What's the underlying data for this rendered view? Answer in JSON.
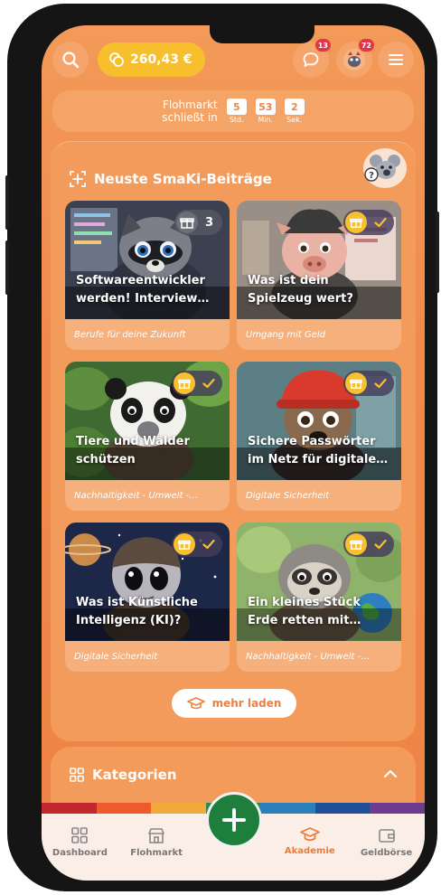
{
  "header": {
    "balance": "260,43 €",
    "chat_badge": "13",
    "avatar_badge": "72",
    "icons": [
      "search-icon",
      "coins-icon",
      "chat-bubble-icon",
      "avatar-icon",
      "hamburger-menu-icon"
    ]
  },
  "countdown": {
    "label_line1": "Flohmarkt",
    "label_line2": "schließt in",
    "hours": "5",
    "hours_unit": "Std.",
    "minutes": "53",
    "minutes_unit": "Min.",
    "seconds": "2",
    "seconds_unit": "Sek."
  },
  "latest": {
    "title": "Neuste SmaKi-Beiträge",
    "mascot_question": "?",
    "cards": [
      {
        "title": "Softwareentwickler\nwerden! Interview…",
        "category": "Berufe für deine Zukunft",
        "badge": "3",
        "badge_type": "gift",
        "image": "raccoon-developer"
      },
      {
        "title": "Was ist dein\nSpielzeug wert?",
        "category": "Umgang mit Geld",
        "badge_type": "done",
        "image": "pig-toys"
      },
      {
        "title": "Tiere und Wälder\nschützen",
        "category": "Nachhaltigkeit - Umwelt -…",
        "badge_type": "done",
        "image": "panda-forest"
      },
      {
        "title": "Sichere Passwörter\nim Netz für digitale…",
        "category": "Digitale Sicherheit",
        "badge_type": "done",
        "image": "dog-red-hat"
      },
      {
        "title": "Was ist Künstliche\nIntelligenz (KI)?",
        "category": "Digitale Sicherheit",
        "badge_type": "done",
        "image": "alien-space"
      },
      {
        "title": "Ein kleines Stück\nErde retten mit…",
        "category": "Nachhaltigkeit - Umwelt -…",
        "badge_type": "done",
        "image": "sloth-earth"
      }
    ],
    "more_label": "mehr laden"
  },
  "categories": {
    "title": "Kategorien"
  },
  "colors": {
    "accent": "#ee8445",
    "coin": "#f7bf2e",
    "fab": "#1e7e3c",
    "rainbow": [
      "#c1272d",
      "#ef5a2a",
      "#f2a93b",
      "#2e8b57",
      "#2a7fb8",
      "#1f4f99",
      "#6d3c8f"
    ]
  },
  "nav": {
    "items": [
      {
        "label": "Dashboard",
        "icon": "grid-icon"
      },
      {
        "label": "Flohmarkt",
        "icon": "store-icon"
      },
      {
        "label": "Akademie",
        "icon": "graduation-cap-icon",
        "active": true
      },
      {
        "label": "Geldbörse",
        "icon": "wallet-icon"
      }
    ],
    "fab_icon": "plus-icon"
  }
}
